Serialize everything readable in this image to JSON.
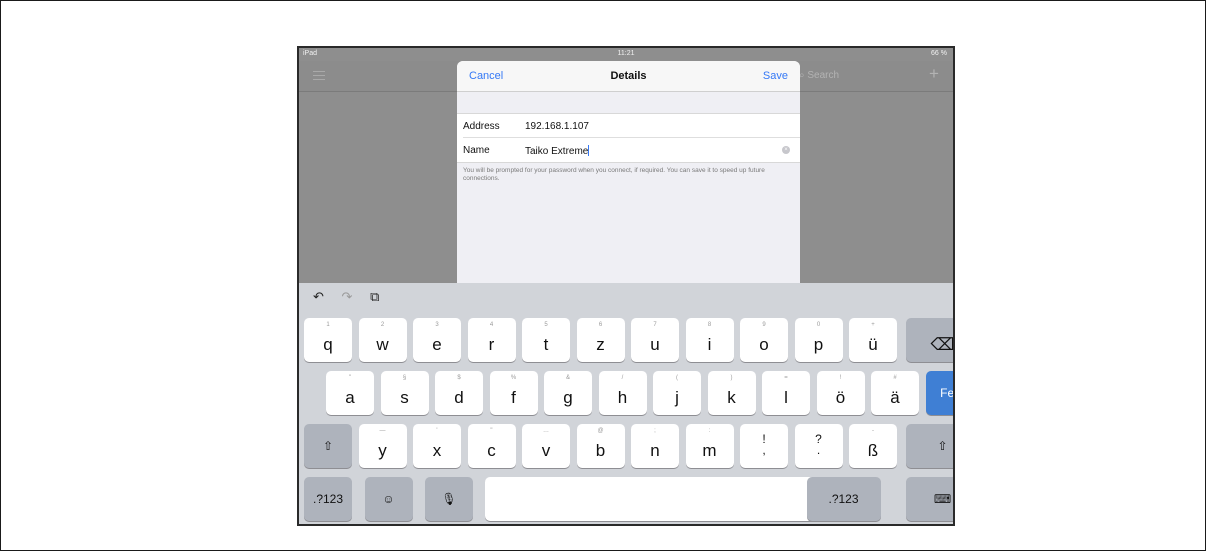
{
  "statusbar": {
    "device": "iPad",
    "time": "11:21",
    "battery": "66 %"
  },
  "background": {
    "search_placeholder": "Search",
    "plus": "+"
  },
  "modal": {
    "cancel": "Cancel",
    "title": "Details",
    "save": "Save",
    "address_label": "Address",
    "address_value": "192.168.1.107",
    "name_label": "Name",
    "name_value": "Taiko Extreme",
    "footer": "You will be prompted for your password when you connect, if required. You can save it to speed up future connections."
  },
  "toolbar": {
    "undo": "↶",
    "redo": "↷",
    "paste": "⧉"
  },
  "keyboard": {
    "row1": [
      {
        "sub": "1",
        "main": "q"
      },
      {
        "sub": "2",
        "main": "w"
      },
      {
        "sub": "3",
        "main": "e"
      },
      {
        "sub": "4",
        "main": "r"
      },
      {
        "sub": "5",
        "main": "t"
      },
      {
        "sub": "6",
        "main": "z"
      },
      {
        "sub": "7",
        "main": "u"
      },
      {
        "sub": "8",
        "main": "i"
      },
      {
        "sub": "9",
        "main": "o"
      },
      {
        "sub": "0",
        "main": "p"
      },
      {
        "sub": "+",
        "main": "ü"
      }
    ],
    "backspace": "⌫",
    "row2": [
      {
        "sub": "\"",
        "main": "a"
      },
      {
        "sub": "§",
        "main": "s"
      },
      {
        "sub": "$",
        "main": "d"
      },
      {
        "sub": "%",
        "main": "f"
      },
      {
        "sub": "&",
        "main": "g"
      },
      {
        "sub": "/",
        "main": "h"
      },
      {
        "sub": "(",
        "main": "j"
      },
      {
        "sub": ")",
        "main": "k"
      },
      {
        "sub": "=",
        "main": "l"
      },
      {
        "sub": "!",
        "main": "ö"
      },
      {
        "sub": "#",
        "main": "ä"
      }
    ],
    "done": "Fertig",
    "row3": [
      {
        "sub": "—",
        "main": "y"
      },
      {
        "sub": "'",
        "main": "x"
      },
      {
        "sub": "\"",
        "main": "c"
      },
      {
        "sub": "…",
        "main": "v"
      },
      {
        "sub": "@",
        "main": "b"
      },
      {
        "sub": ";",
        "main": "n"
      },
      {
        "sub": ":",
        "main": "m"
      },
      {
        "sub": "",
        "main": "!\n,"
      },
      {
        "sub": "",
        "main": "?\n."
      },
      {
        "sub": "-",
        "main": "ß"
      }
    ],
    "shift": "⇧",
    "numbers": ".?123",
    "emoji": "☺",
    "mic": "🎙",
    "dismiss": "⌨"
  }
}
